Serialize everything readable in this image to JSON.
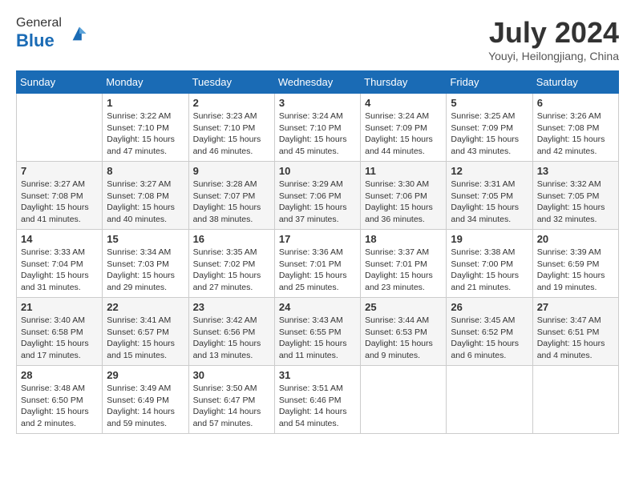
{
  "header": {
    "logo_line1": "General",
    "logo_line2": "Blue",
    "month_title": "July 2024",
    "location": "Youyi, Heilongjiang, China"
  },
  "weekdays": [
    "Sunday",
    "Monday",
    "Tuesday",
    "Wednesday",
    "Thursday",
    "Friday",
    "Saturday"
  ],
  "weeks": [
    [
      {
        "day": "",
        "info": ""
      },
      {
        "day": "1",
        "info": "Sunrise: 3:22 AM\nSunset: 7:10 PM\nDaylight: 15 hours\nand 47 minutes."
      },
      {
        "day": "2",
        "info": "Sunrise: 3:23 AM\nSunset: 7:10 PM\nDaylight: 15 hours\nand 46 minutes."
      },
      {
        "day": "3",
        "info": "Sunrise: 3:24 AM\nSunset: 7:10 PM\nDaylight: 15 hours\nand 45 minutes."
      },
      {
        "day": "4",
        "info": "Sunrise: 3:24 AM\nSunset: 7:09 PM\nDaylight: 15 hours\nand 44 minutes."
      },
      {
        "day": "5",
        "info": "Sunrise: 3:25 AM\nSunset: 7:09 PM\nDaylight: 15 hours\nand 43 minutes."
      },
      {
        "day": "6",
        "info": "Sunrise: 3:26 AM\nSunset: 7:08 PM\nDaylight: 15 hours\nand 42 minutes."
      }
    ],
    [
      {
        "day": "7",
        "info": "Sunrise: 3:27 AM\nSunset: 7:08 PM\nDaylight: 15 hours\nand 41 minutes."
      },
      {
        "day": "8",
        "info": "Sunrise: 3:27 AM\nSunset: 7:08 PM\nDaylight: 15 hours\nand 40 minutes."
      },
      {
        "day": "9",
        "info": "Sunrise: 3:28 AM\nSunset: 7:07 PM\nDaylight: 15 hours\nand 38 minutes."
      },
      {
        "day": "10",
        "info": "Sunrise: 3:29 AM\nSunset: 7:06 PM\nDaylight: 15 hours\nand 37 minutes."
      },
      {
        "day": "11",
        "info": "Sunrise: 3:30 AM\nSunset: 7:06 PM\nDaylight: 15 hours\nand 36 minutes."
      },
      {
        "day": "12",
        "info": "Sunrise: 3:31 AM\nSunset: 7:05 PM\nDaylight: 15 hours\nand 34 minutes."
      },
      {
        "day": "13",
        "info": "Sunrise: 3:32 AM\nSunset: 7:05 PM\nDaylight: 15 hours\nand 32 minutes."
      }
    ],
    [
      {
        "day": "14",
        "info": "Sunrise: 3:33 AM\nSunset: 7:04 PM\nDaylight: 15 hours\nand 31 minutes."
      },
      {
        "day": "15",
        "info": "Sunrise: 3:34 AM\nSunset: 7:03 PM\nDaylight: 15 hours\nand 29 minutes."
      },
      {
        "day": "16",
        "info": "Sunrise: 3:35 AM\nSunset: 7:02 PM\nDaylight: 15 hours\nand 27 minutes."
      },
      {
        "day": "17",
        "info": "Sunrise: 3:36 AM\nSunset: 7:01 PM\nDaylight: 15 hours\nand 25 minutes."
      },
      {
        "day": "18",
        "info": "Sunrise: 3:37 AM\nSunset: 7:01 PM\nDaylight: 15 hours\nand 23 minutes."
      },
      {
        "day": "19",
        "info": "Sunrise: 3:38 AM\nSunset: 7:00 PM\nDaylight: 15 hours\nand 21 minutes."
      },
      {
        "day": "20",
        "info": "Sunrise: 3:39 AM\nSunset: 6:59 PM\nDaylight: 15 hours\nand 19 minutes."
      }
    ],
    [
      {
        "day": "21",
        "info": "Sunrise: 3:40 AM\nSunset: 6:58 PM\nDaylight: 15 hours\nand 17 minutes."
      },
      {
        "day": "22",
        "info": "Sunrise: 3:41 AM\nSunset: 6:57 PM\nDaylight: 15 hours\nand 15 minutes."
      },
      {
        "day": "23",
        "info": "Sunrise: 3:42 AM\nSunset: 6:56 PM\nDaylight: 15 hours\nand 13 minutes."
      },
      {
        "day": "24",
        "info": "Sunrise: 3:43 AM\nSunset: 6:55 PM\nDaylight: 15 hours\nand 11 minutes."
      },
      {
        "day": "25",
        "info": "Sunrise: 3:44 AM\nSunset: 6:53 PM\nDaylight: 15 hours\nand 9 minutes."
      },
      {
        "day": "26",
        "info": "Sunrise: 3:45 AM\nSunset: 6:52 PM\nDaylight: 15 hours\nand 6 minutes."
      },
      {
        "day": "27",
        "info": "Sunrise: 3:47 AM\nSunset: 6:51 PM\nDaylight: 15 hours\nand 4 minutes."
      }
    ],
    [
      {
        "day": "28",
        "info": "Sunrise: 3:48 AM\nSunset: 6:50 PM\nDaylight: 15 hours\nand 2 minutes."
      },
      {
        "day": "29",
        "info": "Sunrise: 3:49 AM\nSunset: 6:49 PM\nDaylight: 14 hours\nand 59 minutes."
      },
      {
        "day": "30",
        "info": "Sunrise: 3:50 AM\nSunset: 6:47 PM\nDaylight: 14 hours\nand 57 minutes."
      },
      {
        "day": "31",
        "info": "Sunrise: 3:51 AM\nSunset: 6:46 PM\nDaylight: 14 hours\nand 54 minutes."
      },
      {
        "day": "",
        "info": ""
      },
      {
        "day": "",
        "info": ""
      },
      {
        "day": "",
        "info": ""
      }
    ]
  ]
}
